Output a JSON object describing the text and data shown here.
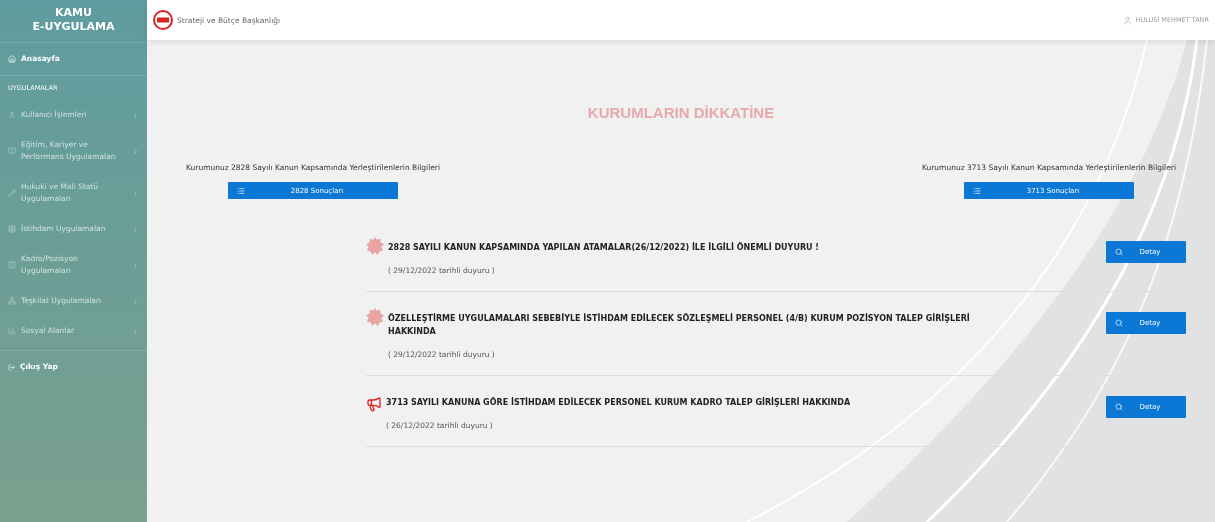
{
  "sidebar": {
    "brand": [
      "KAMU",
      "E-UYGULAMA"
    ],
    "items": [
      {
        "kind": "home",
        "label": "Anasayfa"
      },
      {
        "kind": "section",
        "label": "UYGULAMALAR"
      },
      {
        "kind": "group",
        "label": "Kullanıcı İşlemleri"
      },
      {
        "kind": "group",
        "label": "Eğitim, Kariyer ve Performans Uygulamaları"
      },
      {
        "kind": "group",
        "label": "Hukuki ve Mali Statü Uygulamaları"
      },
      {
        "kind": "group",
        "label": "İstihdam Uygulamaları"
      },
      {
        "kind": "group",
        "label": "Kadro/Pozisyon Uygulamaları"
      },
      {
        "kind": "group",
        "label": "Teşkilat Uygulamaları"
      },
      {
        "kind": "group",
        "label": "Sosyal Alanlar"
      },
      {
        "kind": "logout",
        "label": "Çıkış Yap"
      }
    ]
  },
  "header": {
    "org": "Strateji ve Bütçe Başkanlığı",
    "user": "HULUSİ MEHMET TANR"
  },
  "notice_title": "KURUMLARIN DİKKATİNE",
  "results": [
    {
      "caption": "Kurumunuz 2828 Sayılı Kanun Kapsamında Yerleştirilenlerin Bilgileri",
      "button": "2828 Sonuçları"
    },
    {
      "caption": "Kurumunuz 3713 Sayılı Kanun Kapsamında Yerleştirilenlerin Bilgileri",
      "button": "3713 Sonuçları"
    }
  ],
  "announcements": [
    {
      "kind": "new",
      "title": "2828 SAYILI KANUN KAPSAMINDA YAPILAN ATAMALAR(26/12/2022) İLE İLGİLİ ÖNEMLİ DUYURU !",
      "date": "( 29/12/2022 tarihli duyuru )",
      "button": "Detay"
    },
    {
      "kind": "new",
      "title": "ÖZELLEŞTİRME UYGULAMALARI SEBEBİYLE İSTİHDAM EDİLECEK SÖZLEŞMELİ PERSONEL (4/B) KURUM POZİSYON TALEP GİRİŞLERİ HAKKINDA",
      "date": "( 29/12/2022 tarihli duyuru )",
      "button": "Detay"
    },
    {
      "kind": "megaphone",
      "title": "3713 SAYILI KANUNA GÖRE İSTİHDAM EDİLECEK PERSONEL KURUM KADRO TALEP GİRİŞLERİ HAKKINDA",
      "date": "( 26/12/2022 tarihli duyuru )",
      "button": "Detay"
    }
  ]
}
